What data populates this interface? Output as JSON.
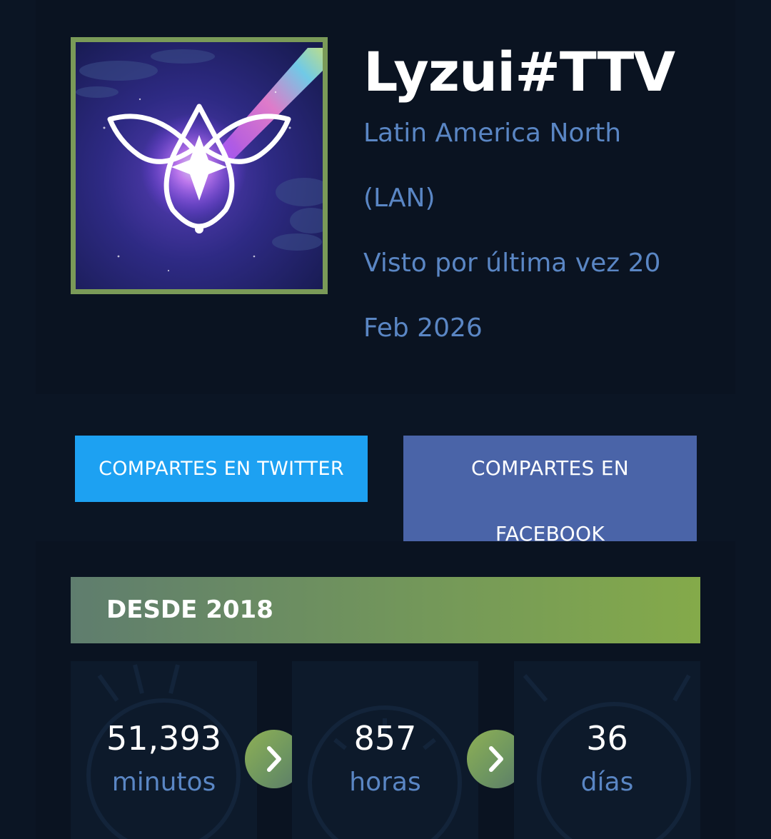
{
  "profile": {
    "summoner_name": "Lyzui#TTV",
    "region_line1": "Latin America North",
    "region_line2": "(LAN)",
    "last_seen_line1": "Visto por última vez 20",
    "last_seen_line2": "Feb 2026",
    "avatar_icon": "profile-icon-emblem",
    "avatar_border_color": "#7a9a58"
  },
  "share": {
    "twitter_label": "COMPARTES EN TWITTER",
    "facebook_line1": "COMPARTES EN",
    "facebook_line2": "FACEBOOK",
    "twitter_color": "#1da1f2",
    "facebook_color": "#4a64a8"
  },
  "time": {
    "banner_label": "DESDE 2018",
    "stats": [
      {
        "value": "51,393",
        "unit": "minutos"
      },
      {
        "value": "857",
        "unit": "horas"
      },
      {
        "value": "36",
        "unit": "días"
      }
    ],
    "arrow_icon": "chevron-right-icon"
  },
  "colors": {
    "background": "#0b1524",
    "accent_blue_text": "#5a86c4",
    "banner_green": "#84aa4a"
  }
}
